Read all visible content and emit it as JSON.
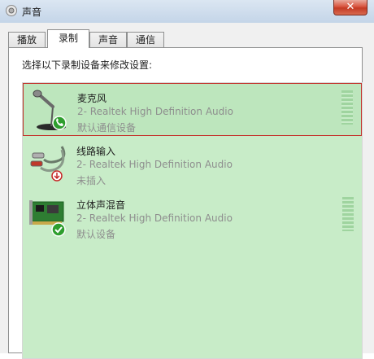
{
  "window": {
    "title": "声音",
    "close_label": "✕"
  },
  "tabs": [
    {
      "label": "播放",
      "active": false
    },
    {
      "label": "录制",
      "active": true
    },
    {
      "label": "声音",
      "active": false
    },
    {
      "label": "通信",
      "active": false
    }
  ],
  "recording": {
    "instructions": "选择以下录制设备来修改设置:",
    "devices": [
      {
        "name": "麦克风",
        "description": "2- Realtek High Definition Audio",
        "status": "默认通信设备",
        "icon": "microphone-icon",
        "badge": "phone-badge-icon",
        "selected": true
      },
      {
        "name": "线路输入",
        "description": "2- Realtek High Definition Audio",
        "status": "未插入",
        "icon": "line-in-cable-icon",
        "badge": "unplugged-badge-icon",
        "selected": false
      },
      {
        "name": "立体声混音",
        "description": "2- Realtek High Definition Audio",
        "status": "默认设备",
        "icon": "sound-card-icon",
        "badge": "checkmark-badge-icon",
        "selected": false
      }
    ]
  },
  "colors": {
    "list_background": "#c8ecc8",
    "selection_border": "#c4312b",
    "default_badge": "#2e9e2e",
    "unplugged_badge": "#c62828"
  }
}
